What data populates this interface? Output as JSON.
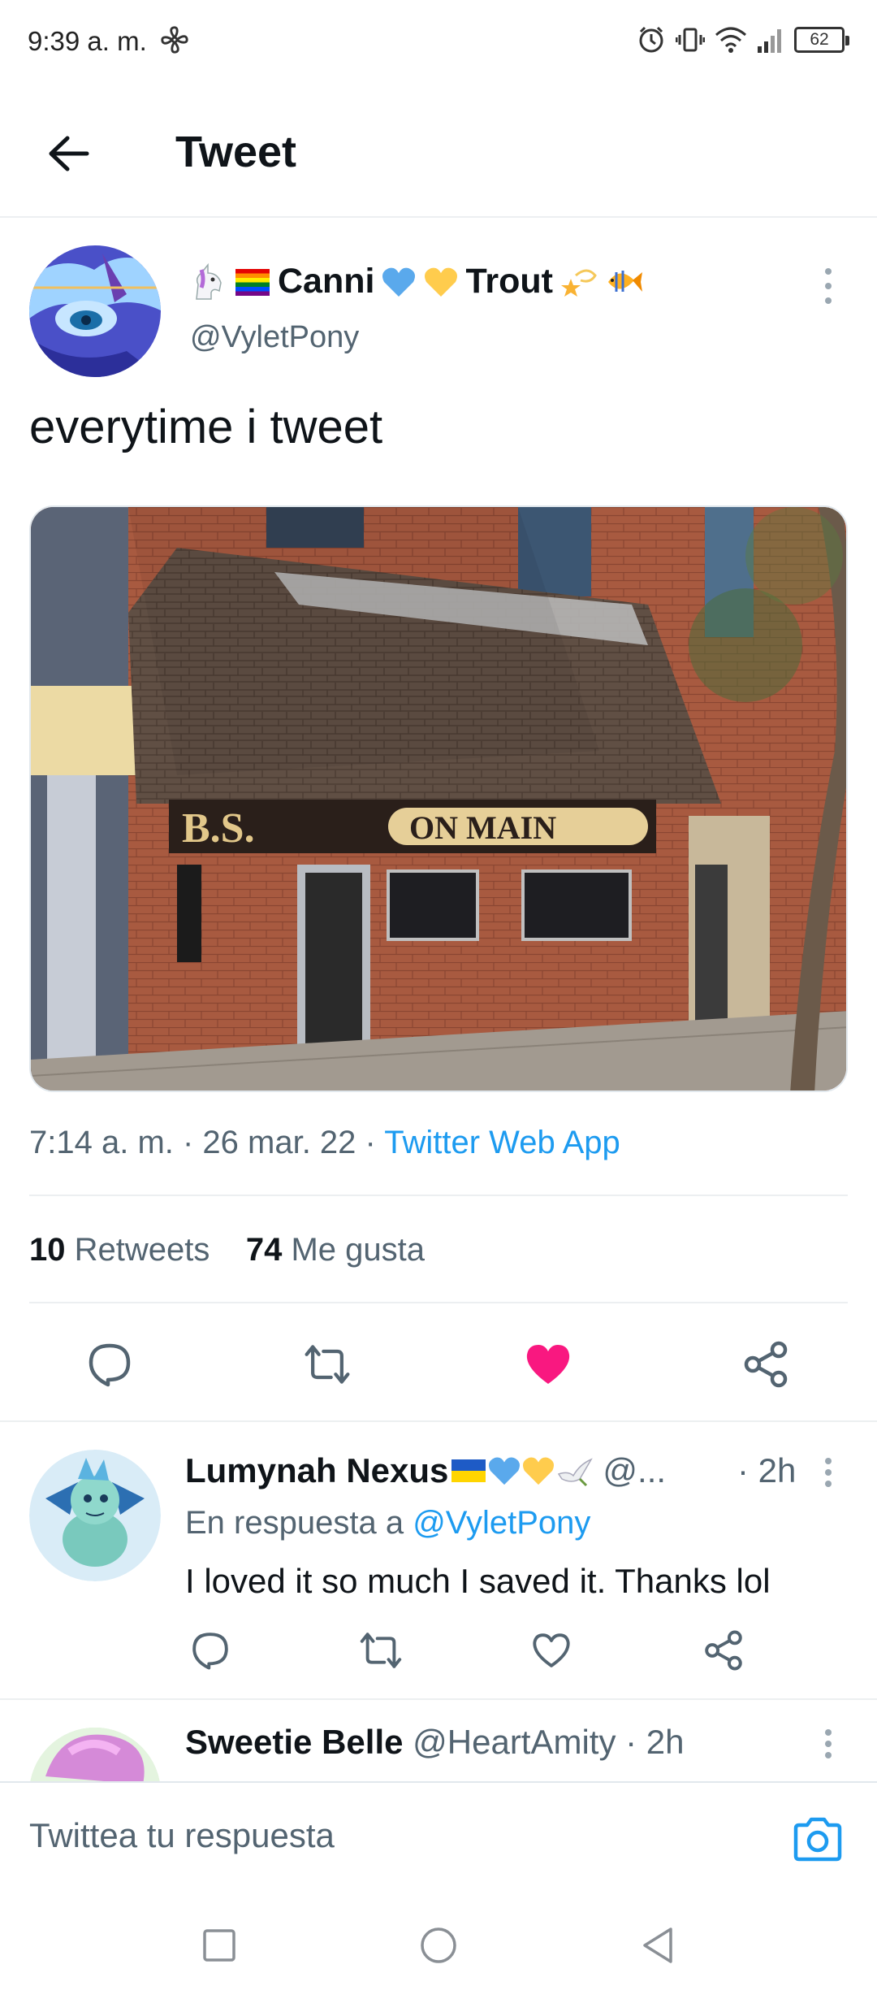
{
  "status_bar": {
    "time": "9:39 a. m.",
    "battery": "62"
  },
  "header": {
    "title": "Tweet"
  },
  "tweet": {
    "author_name": "Canni",
    "author_name_2": "Trout",
    "author_handle": "@VyletPony",
    "text": "everytime i tweet",
    "sign_text_1": "B.S.",
    "sign_text_2": "ON MAIN",
    "time": "7:14 a. m.",
    "date": "26 mar. 22",
    "separator": " · ",
    "source": "Twitter Web App",
    "retweets_count": "10",
    "retweets_label": "Retweets",
    "likes_count": "74",
    "likes_label": "Me gusta",
    "liked": true,
    "colors": {
      "link": "#1d9bf0",
      "like": "#f91880",
      "secondary": "#536471"
    }
  },
  "replies": [
    {
      "name": "Lumynah Nexus",
      "handle": "@...",
      "time": "· 2h",
      "reply_to_label": "En respuesta a",
      "reply_to_handle": "@VyletPony",
      "text": "I loved it so much I saved it. Thanks lol"
    },
    {
      "name": "Sweetie Belle",
      "handle": "@HeartAmity",
      "time": "· 2h"
    }
  ],
  "compose": {
    "placeholder": "Twittea tu respuesta"
  },
  "icons": {
    "back": "arrow-left-icon",
    "more": "more-vertical-icon",
    "reply": "comment-icon",
    "retweet": "retweet-icon",
    "like": "heart-icon",
    "share": "share-icon",
    "camera": "camera-icon"
  }
}
